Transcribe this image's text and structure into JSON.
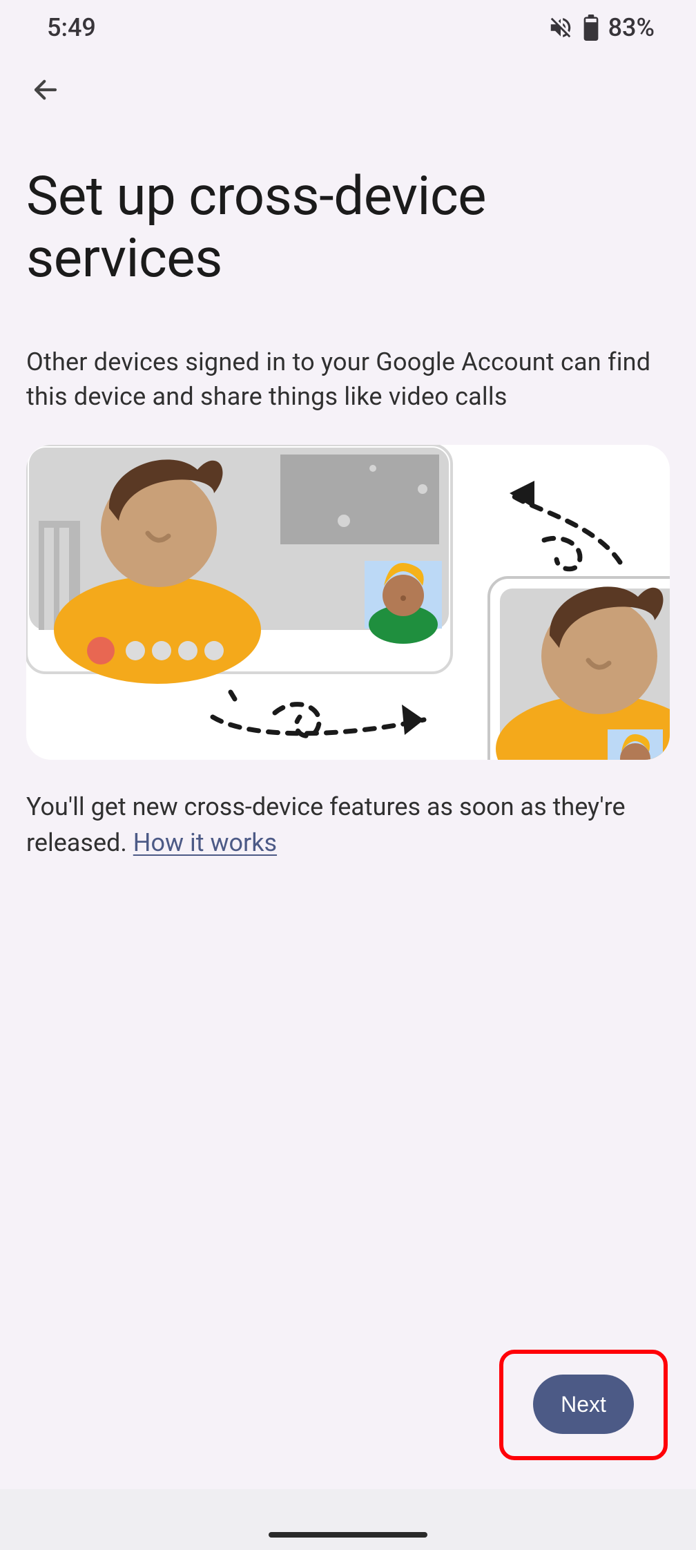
{
  "status_bar": {
    "time": "5:49",
    "battery_percent": "83%"
  },
  "page": {
    "title": "Set up cross-device services",
    "subtitle": "Other devices signed in to your Google Account can find this device and share things like video calls",
    "footer_prefix": "You'll get new cross-device features as soon as they're released. ",
    "link_label": "How it works"
  },
  "actions": {
    "next_label": "Next"
  }
}
